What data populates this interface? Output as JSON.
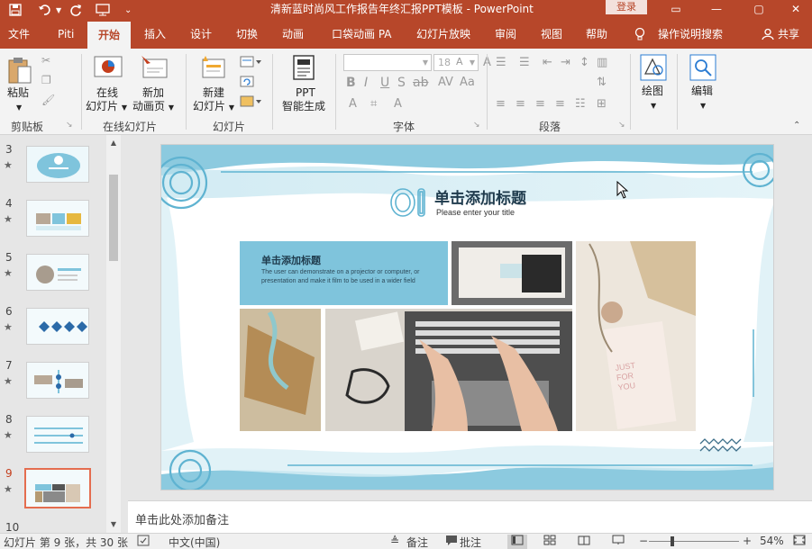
{
  "titlebar": {
    "doc_title": "清新蓝时尚风工作报告年终汇报PPT模板 - PowerPoint",
    "login_label": "登录",
    "controls": [
      "▭",
      "—",
      "▢",
      "✕"
    ]
  },
  "tabs": [
    "文件",
    "Piti",
    "开始",
    "插入",
    "设计",
    "切换",
    "动画",
    "口袋动画 PA",
    "幻灯片放映",
    "审阅",
    "视图",
    "帮助",
    "操作说明搜索",
    "共享"
  ],
  "ribbon": {
    "clipboard": {
      "paste": "粘贴",
      "group": "剪贴板"
    },
    "online": {
      "online_slide_1": "在线",
      "online_slide_2": "幻灯片",
      "new_anim_1": "新加",
      "new_anim_2": "动画页",
      "group": "在线幻灯片"
    },
    "slides": {
      "new_slide_1": "新建",
      "new_slide_2": "幻灯片",
      "group": "幻灯片"
    },
    "ppt": {
      "line1": "PPT",
      "line2": "智能生成"
    },
    "font": {
      "size": "18",
      "group": "字体"
    },
    "paragraph": {
      "group": "段落"
    },
    "drawing": {
      "label": "绘图"
    },
    "editing": {
      "label": "编辑"
    }
  },
  "thumbnails": [
    {
      "num": "3",
      "star": "★"
    },
    {
      "num": "4",
      "star": "★"
    },
    {
      "num": "5",
      "star": "★"
    },
    {
      "num": "6",
      "star": "★"
    },
    {
      "num": "7",
      "star": "★"
    },
    {
      "num": "8",
      "star": "★"
    },
    {
      "num": "9",
      "star": "★"
    },
    {
      "num": "10",
      "star": ""
    }
  ],
  "slide": {
    "title": "单击添加标题",
    "subtitle": "Please enter your title",
    "box_title": "单击添加标题",
    "box_text": "The user can demonstrate on a projector or computer, or presentation and make it film to be used in a wider field",
    "photo_text": "JUST FOR YOU"
  },
  "notes_placeholder": "单击此处添加备注",
  "status": {
    "slide_info": "幻灯片 第 9 张，共 30 张",
    "language": "中文(中国)",
    "notes": "备注",
    "comments": "批注",
    "zoom": "54%"
  },
  "colors": {
    "accent": "#b7472a",
    "slide_blue": "#7fc4dc"
  }
}
